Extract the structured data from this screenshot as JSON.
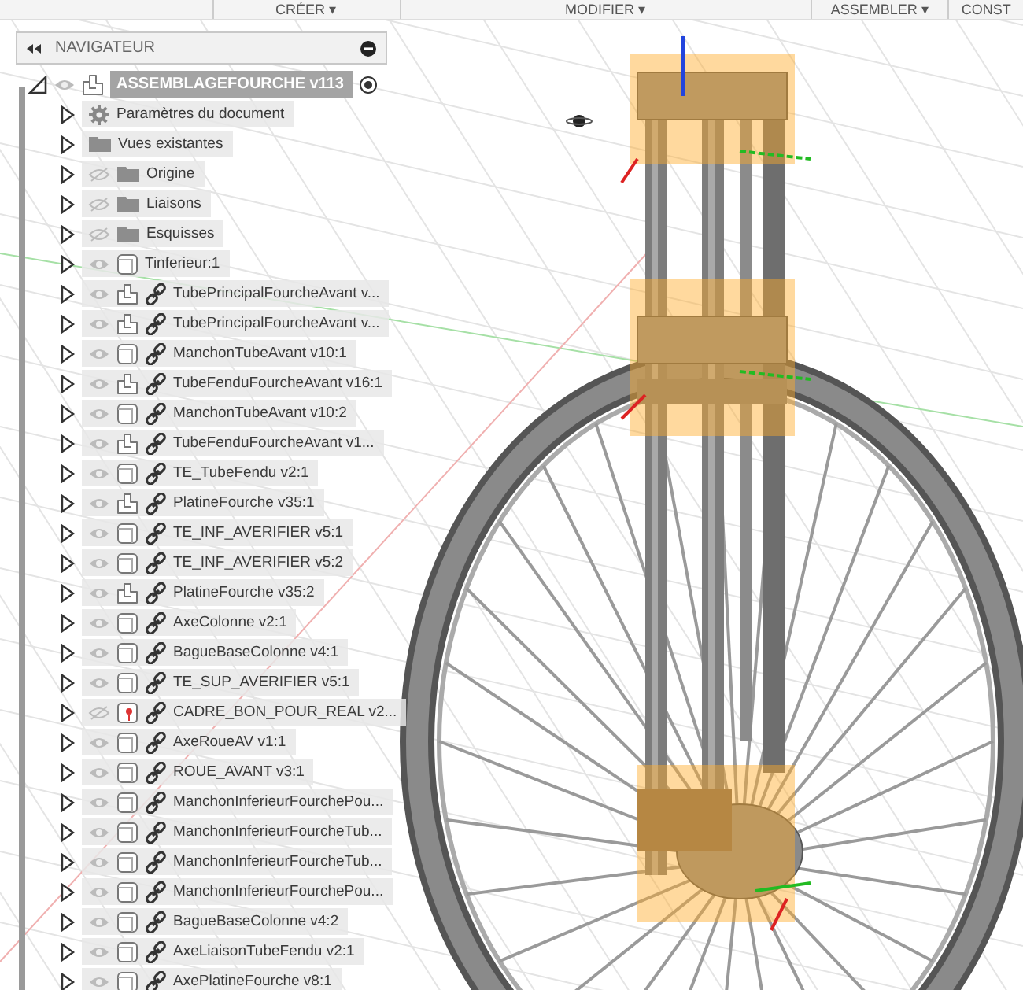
{
  "toolbar": {
    "menus": [
      {
        "label": "CRÉER",
        "caret": "▾"
      },
      {
        "label": "MODIFIER",
        "caret": "▾"
      },
      {
        "label": "ASSEMBLER",
        "caret": "▾"
      },
      {
        "label": "CONST"
      }
    ]
  },
  "navigator": {
    "title": "NAVIGATEUR",
    "root": {
      "label": "ASSEMBLAGEFOURCHE v113",
      "expanded": true,
      "visible": true,
      "selected": true,
      "active": true
    },
    "items": [
      {
        "label": "Paramètres du document",
        "kind": "gear"
      },
      {
        "label": "Vues existantes",
        "kind": "folder"
      },
      {
        "label": "Origine",
        "kind": "folder",
        "visible": false
      },
      {
        "label": "Liaisons",
        "kind": "folder",
        "visible": false
      },
      {
        "label": "Esquisses",
        "kind": "folder",
        "visible": false
      },
      {
        "label": "Tinferieur:1",
        "kind": "body",
        "visible": true,
        "linked": false
      },
      {
        "label": "TubePrincipalFourcheAvant v...",
        "kind": "comp",
        "visible": true,
        "linked": true
      },
      {
        "label": "TubePrincipalFourcheAvant v...",
        "kind": "comp",
        "visible": true,
        "linked": true
      },
      {
        "label": "ManchonTubeAvant v10:1",
        "kind": "body",
        "visible": true,
        "linked": true
      },
      {
        "label": "TubeFenduFourcheAvant v16:1",
        "kind": "comp",
        "visible": true,
        "linked": true
      },
      {
        "label": "ManchonTubeAvant v10:2",
        "kind": "body",
        "visible": true,
        "linked": true
      },
      {
        "label": "TubeFenduFourcheAvant v1...",
        "kind": "comp",
        "visible": true,
        "linked": true
      },
      {
        "label": "TE_TubeFendu v2:1",
        "kind": "body",
        "visible": true,
        "linked": true
      },
      {
        "label": "PlatineFourche v35:1",
        "kind": "comp",
        "visible": true,
        "linked": true
      },
      {
        "label": "TE_INF_AVERIFIER v5:1",
        "kind": "body",
        "visible": true,
        "linked": true
      },
      {
        "label": "TE_INF_AVERIFIER v5:2",
        "kind": "body",
        "visible": true,
        "linked": true
      },
      {
        "label": "PlatineFourche v35:2",
        "kind": "comp",
        "visible": true,
        "linked": true
      },
      {
        "label": "AxeColonne v2:1",
        "kind": "body",
        "visible": true,
        "linked": true
      },
      {
        "label": "BagueBaseColonne v4:1",
        "kind": "body",
        "visible": true,
        "linked": true
      },
      {
        "label": "TE_SUP_AVERIFIER v5:1",
        "kind": "body",
        "visible": true,
        "linked": true
      },
      {
        "label": "CADRE_BON_POUR_REAL v2...",
        "kind": "pinned",
        "visible": false,
        "linked": true
      },
      {
        "label": "AxeRoueAV v1:1",
        "kind": "body",
        "visible": true,
        "linked": true
      },
      {
        "label": "ROUE_AVANT v3:1",
        "kind": "body",
        "visible": true,
        "linked": true
      },
      {
        "label": "ManchonInferieurFourchePou...",
        "kind": "body",
        "visible": true,
        "linked": true
      },
      {
        "label": "ManchonInferieurFourcheTub...",
        "kind": "body",
        "visible": true,
        "linked": true
      },
      {
        "label": "ManchonInferieurFourcheTub...",
        "kind": "body",
        "visible": true,
        "linked": true
      },
      {
        "label": "ManchonInferieurFourchePou...",
        "kind": "body",
        "visible": true,
        "linked": true
      },
      {
        "label": "BagueBaseColonne v4:2",
        "kind": "body",
        "visible": true,
        "linked": true
      },
      {
        "label": "AxeLiaisonTubeFendu v2:1",
        "kind": "body",
        "visible": true,
        "linked": true
      },
      {
        "label": "AxePlatineFourche v8:1",
        "kind": "body",
        "visible": true,
        "linked": true
      }
    ]
  }
}
